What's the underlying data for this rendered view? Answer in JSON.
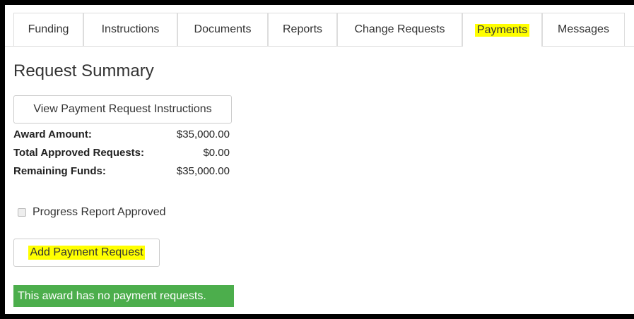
{
  "tabs": [
    {
      "label": "Funding",
      "active": false
    },
    {
      "label": "Instructions",
      "active": false
    },
    {
      "label": "Documents",
      "active": false
    },
    {
      "label": "Reports",
      "active": false
    },
    {
      "label": "Change Requests",
      "active": false
    },
    {
      "label": "Payments",
      "active": true
    },
    {
      "label": "Messages",
      "active": false
    }
  ],
  "main": {
    "title": "Request Summary",
    "instructions_button": "View Payment Request Instructions",
    "summary": [
      {
        "label": "Award Amount:",
        "value": "$35,000.00"
      },
      {
        "label": "Total Approved Requests:",
        "value": "$0.00"
      },
      {
        "label": "Remaining Funds:",
        "value": "$35,000.00"
      }
    ],
    "progress_checkbox": {
      "label": "Progress Report Approved",
      "checked": false
    },
    "add_button": "Add Payment Request",
    "alert": "This award has no payment requests."
  },
  "colors": {
    "highlight": "#ffff00",
    "success": "#4cae4c",
    "border": "#dddddd"
  }
}
